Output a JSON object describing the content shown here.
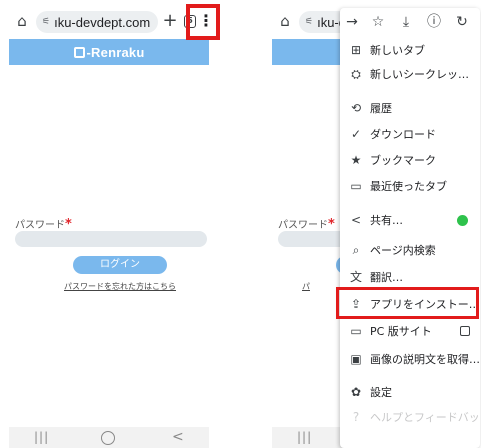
{
  "left": {
    "url": "ıku-devdept.com",
    "tab_count": "5",
    "app_title": "-Renraku",
    "password_label": "パスワード",
    "required_mark": "*",
    "login_button": "ログイン",
    "forgot_link": "パスワードを忘れた方はこちら"
  },
  "right": {
    "url": "ıku-d",
    "password_label": "パスワード",
    "required_mark": "*",
    "forgot_fragment": "パ"
  },
  "menu": {
    "top_icons": [
      "forward-arrow-icon",
      "star-icon",
      "download-icon",
      "info-icon",
      "reload-icon"
    ],
    "items": [
      {
        "label": "新しいタブ",
        "icon": "new-tab-icon"
      },
      {
        "label": "新しいシークレッ…",
        "icon": "incognito-icon"
      },
      {
        "label": "履歴",
        "icon": "history-icon"
      },
      {
        "label": "ダウンロード",
        "icon": "download-check-icon"
      },
      {
        "label": "ブックマーク",
        "icon": "star-icon"
      },
      {
        "label": "最近使ったタブ",
        "icon": "recent-tabs-icon"
      },
      {
        "label": "共有…",
        "icon": "share-icon"
      },
      {
        "label": "ページ内検索",
        "icon": "find-in-page-icon"
      },
      {
        "label": "翻訳…",
        "icon": "translate-icon"
      },
      {
        "label": "アプリをインストー…",
        "icon": "install-app-icon"
      },
      {
        "label": "PC 版サイト",
        "icon": "desktop-icon"
      },
      {
        "label": "画像の説明文を取得…",
        "icon": "image-description-icon"
      },
      {
        "label": "設定",
        "icon": "settings-icon"
      },
      {
        "label": "ヘルプとフィードバック",
        "icon": "help-icon"
      }
    ]
  },
  "navbar": {
    "recents": "|||",
    "back": "<"
  },
  "colors": {
    "accent": "#7ab8ed",
    "highlight": "#e21b1b",
    "share_green": "#2ec24c"
  }
}
